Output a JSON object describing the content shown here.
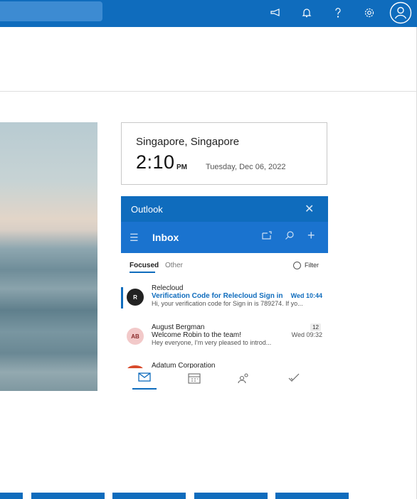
{
  "topbar": {
    "icons": [
      "megaphone-icon",
      "bell-icon",
      "help-icon",
      "settings-icon",
      "account-icon"
    ]
  },
  "clock": {
    "city": "Singapore, Singapore",
    "time": "2:10",
    "ampm": "PM",
    "date": "Tuesday, Dec 06, 2022"
  },
  "outlook": {
    "title": "Outlook",
    "close": "✕",
    "folder": "Inbox",
    "tabs": {
      "focused": "Focused",
      "other": "Other",
      "filter": "Filter"
    },
    "mails": [
      {
        "sender": "Relecloud",
        "subject": "Verification Code for Relecloud Sign in",
        "preview": "Hi, your verification code for Sign in is 789274. If yo...",
        "time": "Wed 10:44",
        "avatar": "R",
        "unread": true
      },
      {
        "sender": "August Bergman",
        "subject": "Welcome Robin to the team!",
        "preview": "Hey everyone, I'm very pleased to introd...",
        "time": "Wed 09:32",
        "count": "12",
        "avatar": "AB",
        "unread": false
      },
      {
        "sender": "Adatum Corporation",
        "subject": "",
        "preview": "",
        "time": "",
        "avatar": "",
        "unread": false
      }
    ],
    "bottom_icons": [
      "mail-icon",
      "calendar-icon",
      "people-icon",
      "todo-icon"
    ]
  },
  "colors": {
    "brand": "#0f6cbd"
  }
}
